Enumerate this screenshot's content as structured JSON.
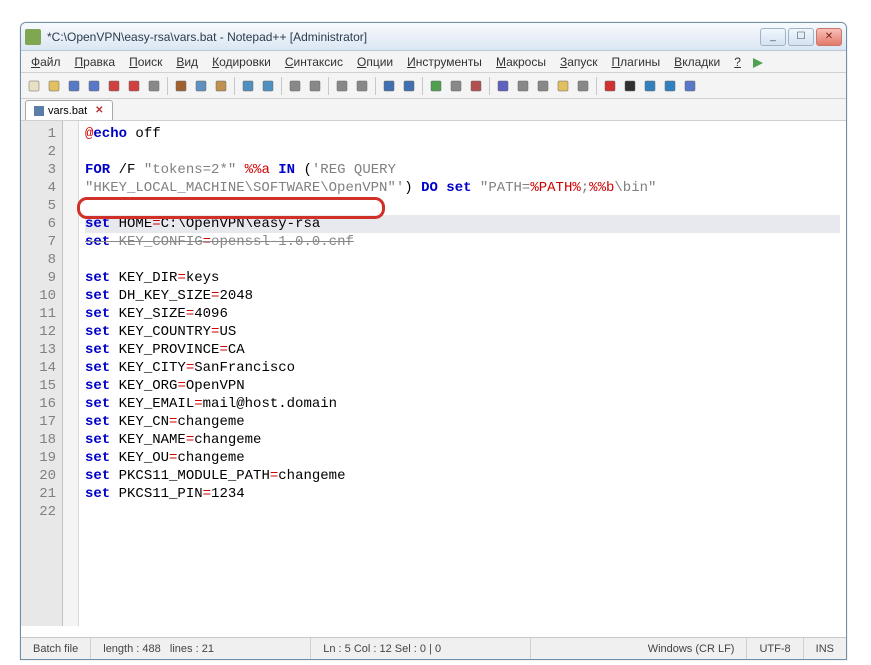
{
  "window": {
    "title": "*C:\\OpenVPN\\easy-rsa\\vars.bat - Notepad++ [Administrator]",
    "min": "_",
    "max": "☐",
    "close": "✕"
  },
  "menus": [
    "Файл",
    "Правка",
    "Поиск",
    "Вид",
    "Кодировки",
    "Синтаксис",
    "Опции",
    "Инструменты",
    "Макросы",
    "Запуск",
    "Плагины",
    "Вкладки",
    "?"
  ],
  "tab": {
    "label": "vars.bat",
    "close": "✕"
  },
  "code": {
    "lines": [
      [
        {
          "c": "op",
          "t": "@"
        },
        {
          "c": "kw",
          "t": "echo"
        },
        {
          "c": "",
          "t": " off"
        }
      ],
      [],
      [
        {
          "c": "kw",
          "t": "FOR"
        },
        {
          "c": "",
          "t": " /F "
        },
        {
          "c": "str",
          "t": "\"tokens=2*\""
        },
        {
          "c": "",
          "t": " "
        },
        {
          "c": "op",
          "t": "%%a"
        },
        {
          "c": "",
          "t": " "
        },
        {
          "c": "kw",
          "t": "IN"
        },
        {
          "c": "",
          "t": " ("
        },
        {
          "c": "str",
          "t": "'REG QUERY"
        }
      ],
      [
        {
          "c": "str",
          "t": "\"HKEY_LOCAL_MACHINE\\SOFTWARE\\OpenVPN\"'"
        },
        {
          "c": "",
          "t": ") "
        },
        {
          "c": "kw",
          "t": "DO"
        },
        {
          "c": "",
          "t": " "
        },
        {
          "c": "kw",
          "t": "set"
        },
        {
          "c": "",
          "t": " "
        },
        {
          "c": "str",
          "t": "\"PATH="
        },
        {
          "c": "op",
          "t": "%PATH%"
        },
        {
          "c": "str",
          "t": ";"
        },
        {
          "c": "op",
          "t": "%%b"
        },
        {
          "c": "str",
          "t": "\\bin\""
        }
      ],
      [],
      [
        {
          "c": "kw",
          "t": "set"
        },
        {
          "c": "",
          "t": " HOME"
        },
        {
          "c": "op",
          "t": "="
        },
        {
          "c": "",
          "t": "C:\\OpenVPN\\easy-rsa"
        }
      ],
      [
        {
          "c": "kw",
          "t": "set"
        },
        {
          "c": "",
          "t": " KEY_CONFIG"
        },
        {
          "c": "op",
          "t": "="
        },
        {
          "c": "",
          "t": "openssl-1.0.0.cnf"
        }
      ],
      [],
      [
        {
          "c": "kw",
          "t": "set"
        },
        {
          "c": "",
          "t": " KEY_DIR"
        },
        {
          "c": "op",
          "t": "="
        },
        {
          "c": "",
          "t": "keys"
        }
      ],
      [
        {
          "c": "kw",
          "t": "set"
        },
        {
          "c": "",
          "t": " DH_KEY_SIZE"
        },
        {
          "c": "op",
          "t": "="
        },
        {
          "c": "",
          "t": "2048"
        }
      ],
      [
        {
          "c": "kw",
          "t": "set"
        },
        {
          "c": "",
          "t": " KEY_SIZE"
        },
        {
          "c": "op",
          "t": "="
        },
        {
          "c": "",
          "t": "4096"
        }
      ],
      [
        {
          "c": "kw",
          "t": "set"
        },
        {
          "c": "",
          "t": " KEY_COUNTRY"
        },
        {
          "c": "op",
          "t": "="
        },
        {
          "c": "",
          "t": "US"
        }
      ],
      [
        {
          "c": "kw",
          "t": "set"
        },
        {
          "c": "",
          "t": " KEY_PROVINCE"
        },
        {
          "c": "op",
          "t": "="
        },
        {
          "c": "",
          "t": "CA"
        }
      ],
      [
        {
          "c": "kw",
          "t": "set"
        },
        {
          "c": "",
          "t": " KEY_CITY"
        },
        {
          "c": "op",
          "t": "="
        },
        {
          "c": "",
          "t": "SanFrancisco"
        }
      ],
      [
        {
          "c": "kw",
          "t": "set"
        },
        {
          "c": "",
          "t": " KEY_ORG"
        },
        {
          "c": "op",
          "t": "="
        },
        {
          "c": "",
          "t": "OpenVPN"
        }
      ],
      [
        {
          "c": "kw",
          "t": "set"
        },
        {
          "c": "",
          "t": " KEY_EMAIL"
        },
        {
          "c": "op",
          "t": "="
        },
        {
          "c": "",
          "t": "mail@host.domain"
        }
      ],
      [
        {
          "c": "kw",
          "t": "set"
        },
        {
          "c": "",
          "t": " KEY_CN"
        },
        {
          "c": "op",
          "t": "="
        },
        {
          "c": "",
          "t": "changeme"
        }
      ],
      [
        {
          "c": "kw",
          "t": "set"
        },
        {
          "c": "",
          "t": " KEY_NAME"
        },
        {
          "c": "op",
          "t": "="
        },
        {
          "c": "",
          "t": "changeme"
        }
      ],
      [
        {
          "c": "kw",
          "t": "set"
        },
        {
          "c": "",
          "t": " KEY_OU"
        },
        {
          "c": "op",
          "t": "="
        },
        {
          "c": "",
          "t": "changeme"
        }
      ],
      [
        {
          "c": "kw",
          "t": "set"
        },
        {
          "c": "",
          "t": " PKCS11_MODULE_PATH"
        },
        {
          "c": "op",
          "t": "="
        },
        {
          "c": "",
          "t": "changeme"
        }
      ],
      [
        {
          "c": "kw",
          "t": "set"
        },
        {
          "c": "",
          "t": " PKCS11_PIN"
        },
        {
          "c": "op",
          "t": "="
        },
        {
          "c": "",
          "t": "1234"
        }
      ],
      []
    ],
    "highlighted_line": 5,
    "strike_line": 6
  },
  "statusbar": {
    "filetype": "Batch file",
    "length": "length : 488",
    "lines": "lines : 21",
    "pos": "Ln : 5   Col : 12   Sel : 0 | 0",
    "eol": "Windows (CR LF)",
    "encoding": "UTF-8",
    "mode": "INS"
  },
  "toolbar_icons": [
    {
      "n": "new-file-icon",
      "c": "#e8e0c0"
    },
    {
      "n": "open-file-icon",
      "c": "#e0c060"
    },
    {
      "n": "save-icon",
      "c": "#5878c8"
    },
    {
      "n": "save-all-icon",
      "c": "#5878c8"
    },
    {
      "n": "close-icon",
      "c": "#d04040"
    },
    {
      "n": "close-all-icon",
      "c": "#d04040"
    },
    {
      "n": "print-icon",
      "c": "#888"
    },
    "sep",
    {
      "n": "cut-icon",
      "c": "#a06030"
    },
    {
      "n": "copy-icon",
      "c": "#6090c0"
    },
    {
      "n": "paste-icon",
      "c": "#c09050"
    },
    "sep",
    {
      "n": "undo-icon",
      "c": "#5090c0"
    },
    {
      "n": "redo-icon",
      "c": "#5090c0"
    },
    "sep",
    {
      "n": "find-icon",
      "c": "#888"
    },
    {
      "n": "replace-icon",
      "c": "#888"
    },
    "sep",
    {
      "n": "zoom-in-icon",
      "c": "#888"
    },
    {
      "n": "zoom-out-icon",
      "c": "#888"
    },
    "sep",
    {
      "n": "sync-v-icon",
      "c": "#4070b0"
    },
    {
      "n": "sync-h-icon",
      "c": "#4070b0"
    },
    "sep",
    {
      "n": "wrap-icon",
      "c": "#50a050"
    },
    {
      "n": "show-chars-icon",
      "c": "#888"
    },
    {
      "n": "indent-guide-icon",
      "c": "#b05050"
    },
    "sep",
    {
      "n": "lang-icon",
      "c": "#6060c0"
    },
    {
      "n": "doc-map-icon",
      "c": "#888"
    },
    {
      "n": "func-list-icon",
      "c": "#888"
    },
    {
      "n": "folder-view-icon",
      "c": "#e0c060"
    },
    {
      "n": "monitor-icon",
      "c": "#888"
    },
    "sep",
    {
      "n": "record-macro-icon",
      "c": "#d03030"
    },
    {
      "n": "stop-macro-icon",
      "c": "#303030"
    },
    {
      "n": "play-macro-icon",
      "c": "#3080c0"
    },
    {
      "n": "run-macro-icon",
      "c": "#3080c0"
    },
    {
      "n": "save-macro-icon",
      "c": "#5878c8"
    }
  ]
}
